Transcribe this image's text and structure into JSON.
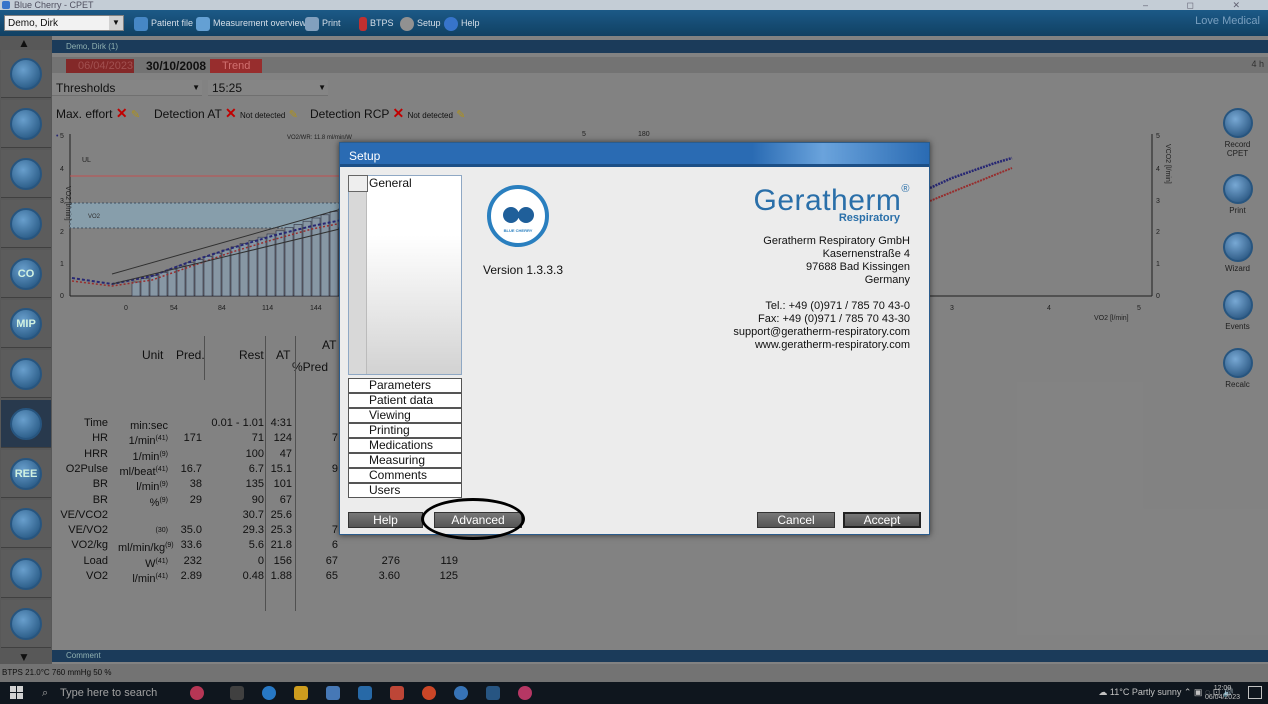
{
  "window": {
    "title": "Blue Cherry - CPET"
  },
  "toolbar": {
    "patient": "Demo, Dirk",
    "items": [
      "Patient file",
      "Measurement overview",
      "Print",
      "BTPS",
      "Setup",
      "Help"
    ],
    "brand": "Love Medical"
  },
  "breadcrumb": "Demo, Dirk (1)",
  "tabs": {
    "prev": "06/04/2023",
    "current": "30/10/2008",
    "trend": "Trend",
    "pager": "4 h"
  },
  "selectors": {
    "view": "Thresholds",
    "time": "15:25"
  },
  "detection": {
    "max_effort": "Max. effort",
    "at": "Detection AT",
    "rcp": "Detection RCP",
    "not_detected": "Not detected"
  },
  "chart_data": {
    "type": "line",
    "title": "",
    "annotations": [
      "VO2/WR: 11.8 ml/min/W",
      "UL",
      "VO2"
    ],
    "left_ylabel": "VO2 [l/min]",
    "right_ylabel": "VCO2 [l/min]",
    "xlabel": "VO2 [l/min]",
    "x_ticks": [
      "0",
      "54",
      "84",
      "114",
      "144"
    ],
    "y_ticks": [
      "0",
      "1",
      "2",
      "3",
      "4",
      "5"
    ],
    "right_x_ticks": [
      "3",
      "4",
      "5"
    ],
    "right_y_ticks": [
      "0",
      "1",
      "2",
      "3",
      "4",
      "5"
    ],
    "top_markers": [
      "5",
      "180"
    ]
  },
  "table": {
    "headers": {
      "unit": "Unit",
      "pred": "Pred.",
      "rest": "Rest",
      "at": "AT",
      "at_top": "AT",
      "pct": "%Pred"
    },
    "rows": [
      {
        "label": "Time",
        "unit": "min:sec",
        "sup": "",
        "pred": "",
        "rest": "0.01 - 1.01",
        "at": "4:31",
        "p3": "",
        "p4": "",
        "p5": ""
      },
      {
        "label": "HR",
        "unit": "1/min",
        "sup": "(41)",
        "pred": "171",
        "rest": "71",
        "at": "124",
        "p3": "7",
        "p4": "",
        "p5": ""
      },
      {
        "label": "HRR",
        "unit": "1/min",
        "sup": "(9)",
        "pred": "",
        "rest": "100",
        "at": "47",
        "p3": "",
        "p4": "",
        "p5": ""
      },
      {
        "label": "O2Pulse",
        "unit": "ml/beat",
        "sup": "(41)",
        "pred": "16.7",
        "rest": "6.7",
        "at": "15.1",
        "p3": "9",
        "p4": "",
        "p5": ""
      },
      {
        "label": "BR",
        "unit": "l/min",
        "sup": "(9)",
        "pred": "38",
        "rest": "135",
        "at": "101",
        "p3": "",
        "p4": "",
        "p5": ""
      },
      {
        "label": "BR",
        "unit": "%",
        "sup": "(9)",
        "pred": "29",
        "rest": "90",
        "at": "67",
        "p3": "",
        "p4": "",
        "p5": ""
      },
      {
        "label": "VE/VCO2",
        "unit": "",
        "sup": "",
        "pred": "",
        "rest": "30.7",
        "at": "25.6",
        "p3": "",
        "p4": "",
        "p5": ""
      },
      {
        "label": "VE/VO2",
        "unit": "",
        "sup": "(30)",
        "pred": "35.0",
        "rest": "29.3",
        "at": "25.3",
        "p3": "7",
        "p4": "",
        "p5": ""
      },
      {
        "label": "VO2/kg",
        "unit": "ml/min/kg",
        "sup": "(9)",
        "pred": "33.6",
        "rest": "5.6",
        "at": "21.8",
        "p3": "6",
        "p4": "",
        "p5": ""
      },
      {
        "label": "Load",
        "unit": "W",
        "sup": "(41)",
        "pred": "232",
        "rest": "0",
        "at": "156",
        "p3": "67",
        "p4": "276",
        "p5": "119"
      },
      {
        "label": "VO2",
        "unit": "l/min",
        "sup": "(41)",
        "pred": "2.89",
        "rest": "0.48",
        "at": "1.88",
        "p3": "65",
        "p4": "3.60",
        "p5": "125"
      }
    ]
  },
  "comment_bar": "Comment",
  "right_sidebar": [
    "Record CPET",
    "Print",
    "Wizard",
    "Events",
    "Recalc"
  ],
  "statusbar": "BTPS  21.0°C  760 mmHg  50 %",
  "taskbar": {
    "search_placeholder": "Type here to search",
    "weather": "11°C  Partly sunny",
    "time": "12:00",
    "date": "06/04/2023"
  },
  "dialog": {
    "title": "Setup",
    "nav_selected": "General",
    "nav_items": [
      "Parameters",
      "Patient data",
      "Viewing",
      "Printing",
      "Medications",
      "Measuring",
      "Comments",
      "Users"
    ],
    "logo_text": "BLUE CHERRY",
    "version": "Version 1.3.3.3",
    "brand": "Geratherm",
    "brand_mark": "®",
    "brand_sub": "Respiratory",
    "address": [
      "Geratherm Respiratory GmbH",
      "Kasernenstraße 4",
      "97688 Bad Kissingen",
      "Germany"
    ],
    "contact": [
      "Tel.: +49 (0)971 / 785 70 43-0",
      "Fax: +49 (0)971 / 785 70 43-30",
      "support@geratherm-respiratory.com",
      "www.geratherm-respiratory.com"
    ],
    "buttons": {
      "help": "Help",
      "advanced": "Advanced",
      "cancel": "Cancel",
      "accept": "Accept"
    }
  },
  "colors": {
    "accent": "#2a6bb3",
    "brand": "#2a6fa9",
    "highlight_ring": "#000000"
  }
}
